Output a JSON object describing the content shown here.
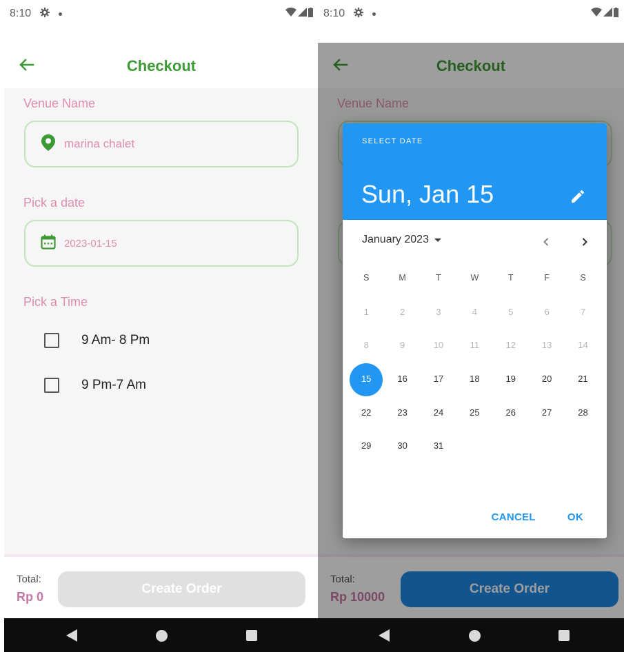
{
  "left": {
    "status": {
      "time": "8:10"
    },
    "appbar": {
      "title": "Checkout"
    },
    "venue": {
      "label": "Venue Name",
      "value": "marina chalet"
    },
    "date": {
      "label": "Pick a date",
      "value": "2023-01-15"
    },
    "time": {
      "label": "Pick a Time",
      "options": [
        "9 Am- 8 Pm",
        "9 Pm-7 Am"
      ]
    },
    "bottom": {
      "total_label": "Total:",
      "total_value": "Rp 0",
      "button": "Create Order"
    }
  },
  "right": {
    "status": {
      "time": "8:10"
    },
    "appbar": {
      "title": "Checkout"
    },
    "venue": {
      "label": "Venue Name"
    },
    "bottom": {
      "total_label": "Total:",
      "total_value": "Rp 10000",
      "button": "Create Order"
    },
    "dialog": {
      "header_label": "SELECT DATE",
      "selected_date": "Sun, Jan 15",
      "month": "January 2023",
      "weekdays": [
        "S",
        "M",
        "T",
        "W",
        "T",
        "F",
        "S"
      ],
      "weeks": [
        [
          "1",
          "2",
          "3",
          "4",
          "5",
          "6",
          "7"
        ],
        [
          "8",
          "9",
          "10",
          "11",
          "12",
          "13",
          "14"
        ],
        [
          "15",
          "16",
          "17",
          "18",
          "19",
          "20",
          "21"
        ],
        [
          "22",
          "23",
          "24",
          "25",
          "26",
          "27",
          "28"
        ],
        [
          "29",
          "30",
          "31",
          "",
          "",
          "",
          ""
        ]
      ],
      "disabled_days": [
        "1",
        "2",
        "3",
        "4",
        "5",
        "6",
        "7",
        "8",
        "9",
        "10",
        "11",
        "12",
        "13",
        "14"
      ],
      "selected_day": "15",
      "cancel": "CANCEL",
      "ok": "OK"
    }
  },
  "colors": {
    "title_green": "#3c9a35",
    "label_pink": "#e08db0",
    "field_border": "#bfe5b8",
    "picker_blue": "#2196f3",
    "button_blue": "#1e88e5",
    "total_purple": "#c476a4"
  }
}
